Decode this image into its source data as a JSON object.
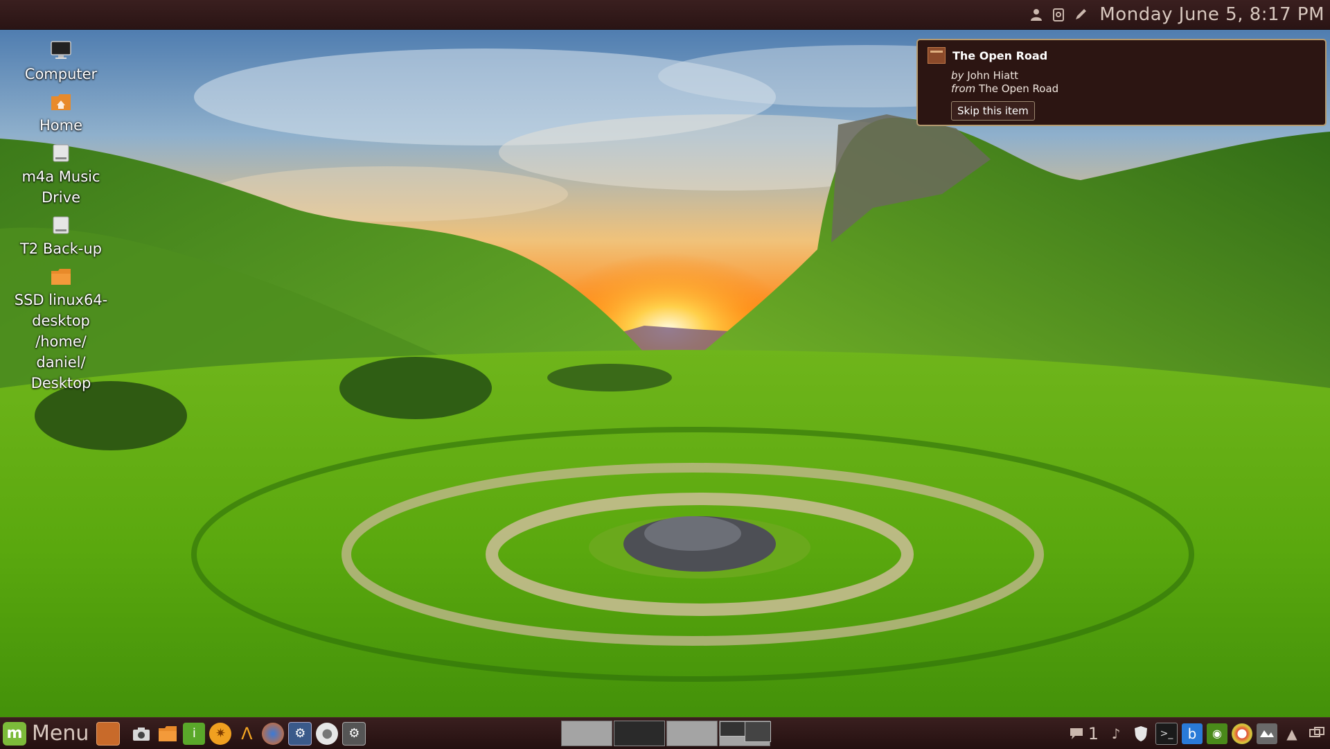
{
  "top_panel": {
    "clock": "Monday June  5,  8:17 PM",
    "tray_icons": [
      "user-icon",
      "clipboard-icon",
      "pen-icon"
    ]
  },
  "desktop_icons": [
    {
      "label": "Computer",
      "icon": "monitor-icon"
    },
    {
      "label": "Home",
      "icon": "home-folder-icon"
    },
    {
      "label": "m4a Music\nDrive",
      "icon": "drive-icon"
    },
    {
      "label": "T2 Back-up",
      "icon": "drive-icon"
    },
    {
      "label": "SSD linux64-\ndesktop\n/home/\ndaniel/\nDesktop",
      "icon": "folder-icon"
    }
  ],
  "notification": {
    "title": "The Open Road",
    "by_prefix": "by",
    "artist": "John Hiatt",
    "from_prefix": "from",
    "album": "The Open Road",
    "button": "Skip this item"
  },
  "bottom_panel": {
    "menu_label": "Menu",
    "launchers": [
      "files-icon",
      "camera-icon",
      "folder-icon",
      "info-icon",
      "wheel-icon",
      "software-icon",
      "firefox-icon",
      "settings-icon",
      "disc-icon",
      "system-monitor-icon"
    ],
    "workspaces": [
      {
        "active": false
      },
      {
        "active": true
      },
      {
        "active": false
      },
      {
        "active": false
      }
    ],
    "notification_count": "1",
    "tray_icons": [
      "chat-icon",
      "music-note-icon",
      "shield-icon",
      "terminal-icon",
      "bluetooth-icon",
      "nvidia-icon",
      "chrome-icon",
      "network-icon",
      "upload-arrow-icon",
      "display-icon"
    ]
  },
  "colors": {
    "panel": "#2f1717",
    "notification_bg": "#2c1512",
    "notification_border": "#b59a6f",
    "panel_text": "#d8c8bf"
  }
}
